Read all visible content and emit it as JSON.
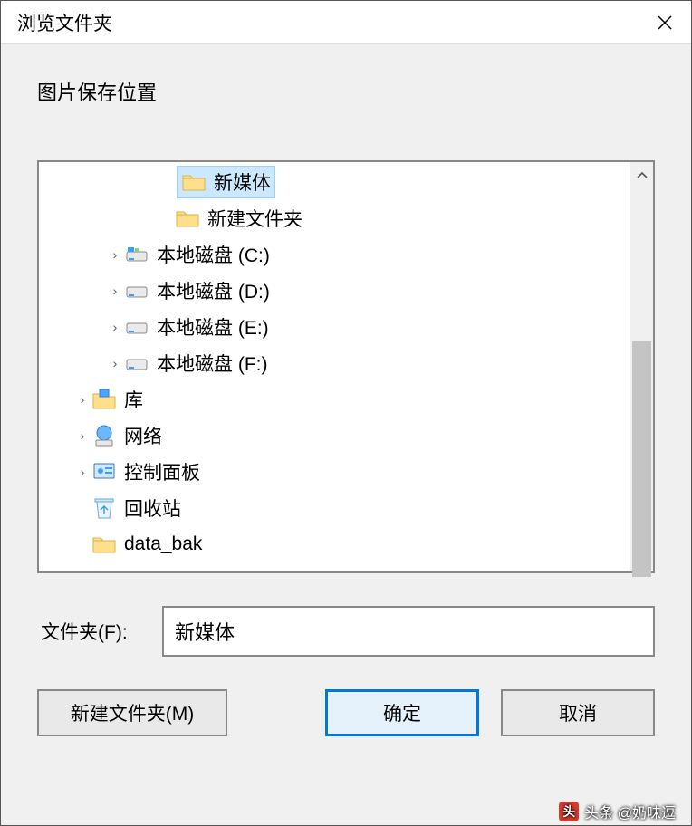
{
  "window": {
    "title": "浏览文件夹",
    "prompt": "图片保存位置"
  },
  "tree": {
    "items": [
      {
        "label": "新媒体",
        "indent": "i2x",
        "expander": "",
        "icon": "folder",
        "selected": true
      },
      {
        "label": "新建文件夹",
        "indent": "i2",
        "expander": "",
        "icon": "folder",
        "selected": false
      },
      {
        "label": "本地磁盘 (C:)",
        "indent": "i1",
        "expander": "›",
        "icon": "disk-c",
        "selected": false
      },
      {
        "label": "本地磁盘 (D:)",
        "indent": "i1",
        "expander": "›",
        "icon": "disk",
        "selected": false
      },
      {
        "label": "本地磁盘 (E:)",
        "indent": "i1",
        "expander": "›",
        "icon": "disk",
        "selected": false
      },
      {
        "label": "本地磁盘 (F:)",
        "indent": "i1",
        "expander": "›",
        "icon": "disk",
        "selected": false
      },
      {
        "label": "库",
        "indent": "i0",
        "expander": "›",
        "icon": "library",
        "selected": false
      },
      {
        "label": "网络",
        "indent": "i0",
        "expander": "›",
        "icon": "network",
        "selected": false
      },
      {
        "label": "控制面板",
        "indent": "i0",
        "expander": "›",
        "icon": "control-panel",
        "selected": false
      },
      {
        "label": "回收站",
        "indent": "i0",
        "expander": "",
        "icon": "recycle-bin",
        "selected": false
      },
      {
        "label": "data_bak",
        "indent": "i0",
        "expander": "",
        "icon": "folder",
        "selected": false
      }
    ]
  },
  "folder_field": {
    "label": "文件夹(F):",
    "value": "新媒体"
  },
  "buttons": {
    "new_folder": "新建文件夹(M)",
    "ok": "确定",
    "cancel": "取消"
  },
  "watermark": "头条 @奶味逗"
}
